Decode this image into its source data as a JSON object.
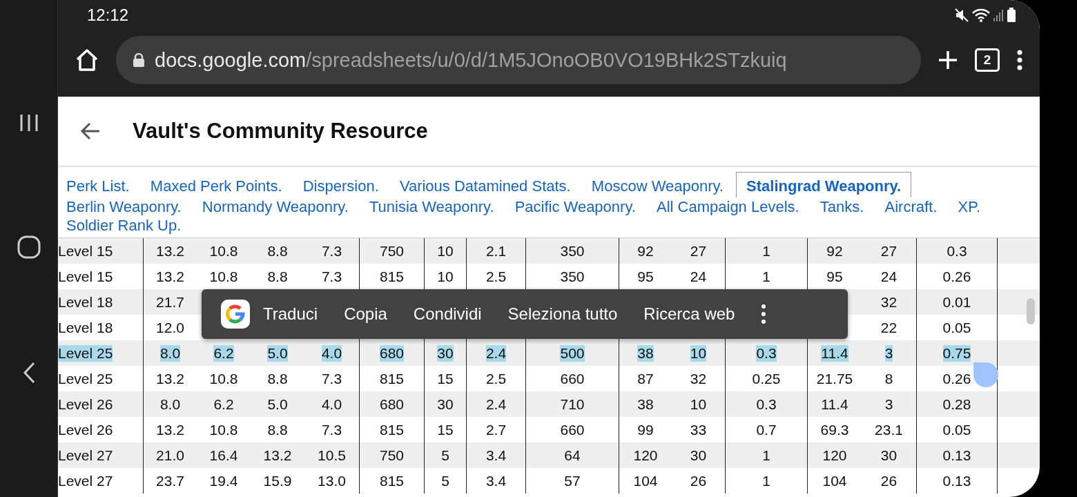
{
  "status_bar": {
    "time": "12:12"
  },
  "browser": {
    "url_host": "docs.google.com",
    "url_path": "/spreadsheets/u/0/d/1M5JOnoOB0VO19BHk2STzkuiq",
    "tab_count": "2"
  },
  "header": {
    "title": "Vault's Community Resource"
  },
  "tabs": [
    {
      "label": "Perk List.",
      "selected": false
    },
    {
      "label": "Maxed Perk Points.",
      "selected": false
    },
    {
      "label": "Dispersion.",
      "selected": false
    },
    {
      "label": "Various Datamined Stats.",
      "selected": false
    },
    {
      "label": "Moscow Weaponry.",
      "selected": false
    },
    {
      "label": "Stalingrad Weaponry.",
      "selected": true
    },
    {
      "label": "Berlin Weaponry.",
      "selected": false
    },
    {
      "label": "Normandy Weaponry.",
      "selected": false
    },
    {
      "label": "Tunisia Weaponry.",
      "selected": false
    },
    {
      "label": "Pacific Weaponry.",
      "selected": false
    },
    {
      "label": "All Campaign Levels.",
      "selected": false
    },
    {
      "label": "Tanks.",
      "selected": false
    },
    {
      "label": "Aircraft.",
      "selected": false
    },
    {
      "label": "XP.",
      "selected": false
    },
    {
      "label": "Soldier Rank Up.",
      "selected": false
    }
  ],
  "table": {
    "rows": [
      {
        "selected": false,
        "cells": [
          "Level 15",
          "13.2",
          "10.8",
          "8.8",
          "7.3",
          "750",
          "10",
          "2.1",
          "350",
          "92",
          "27",
          "1",
          "92",
          "27",
          "0.3"
        ]
      },
      {
        "selected": false,
        "cells": [
          "Level 15",
          "13.2",
          "10.8",
          "8.8",
          "7.3",
          "815",
          "10",
          "2.5",
          "350",
          "95",
          "24",
          "1",
          "95",
          "24",
          "0.26"
        ]
      },
      {
        "selected": false,
        "cells": [
          "Level 18",
          "21.7",
          null,
          null,
          null,
          null,
          null,
          null,
          null,
          null,
          null,
          null,
          null,
          "32",
          "0.01"
        ]
      },
      {
        "selected": false,
        "cells": [
          "Level 18",
          "12.0",
          null,
          null,
          null,
          null,
          null,
          null,
          null,
          null,
          null,
          null,
          null,
          "22",
          "0.05"
        ]
      },
      {
        "selected": true,
        "cells": [
          "Level 25",
          "8.0",
          "6.2",
          "5.0",
          "4.0",
          "680",
          "30",
          "2.4",
          "500",
          "38",
          "10",
          "0.3",
          "11.4",
          "3",
          "0.75"
        ]
      },
      {
        "selected": false,
        "cells": [
          "Level 25",
          "13.2",
          "10.8",
          "8.8",
          "7.3",
          "815",
          "15",
          "2.5",
          "660",
          "87",
          "32",
          "0.25",
          "21.75",
          "8",
          "0.26"
        ]
      },
      {
        "selected": false,
        "cells": [
          "Level 26",
          "8.0",
          "6.2",
          "5.0",
          "4.0",
          "680",
          "30",
          "2.4",
          "710",
          "38",
          "10",
          "0.3",
          "11.4",
          "3",
          "0.28"
        ]
      },
      {
        "selected": false,
        "cells": [
          "Level 26",
          "13.2",
          "10.8",
          "8.8",
          "7.3",
          "815",
          "15",
          "2.7",
          "660",
          "99",
          "33",
          "0.7",
          "69.3",
          "23.1",
          "0.05"
        ]
      },
      {
        "selected": false,
        "cells": [
          "Level 27",
          "21.0",
          "16.4",
          "13.2",
          "10.5",
          "750",
          "5",
          "3.4",
          "64",
          "120",
          "30",
          "1",
          "120",
          "30",
          "0.13"
        ]
      },
      {
        "selected": false,
        "cells": [
          "Level 27",
          "23.7",
          "19.4",
          "15.9",
          "13.0",
          "815",
          "5",
          "3.4",
          "57",
          "104",
          "26",
          "1",
          "104",
          "26",
          "0.13"
        ]
      }
    ]
  },
  "context_menu": {
    "items": [
      "Traduci",
      "Copia",
      "Condividi",
      "Seleziona tutto",
      "Ricerca web"
    ]
  }
}
